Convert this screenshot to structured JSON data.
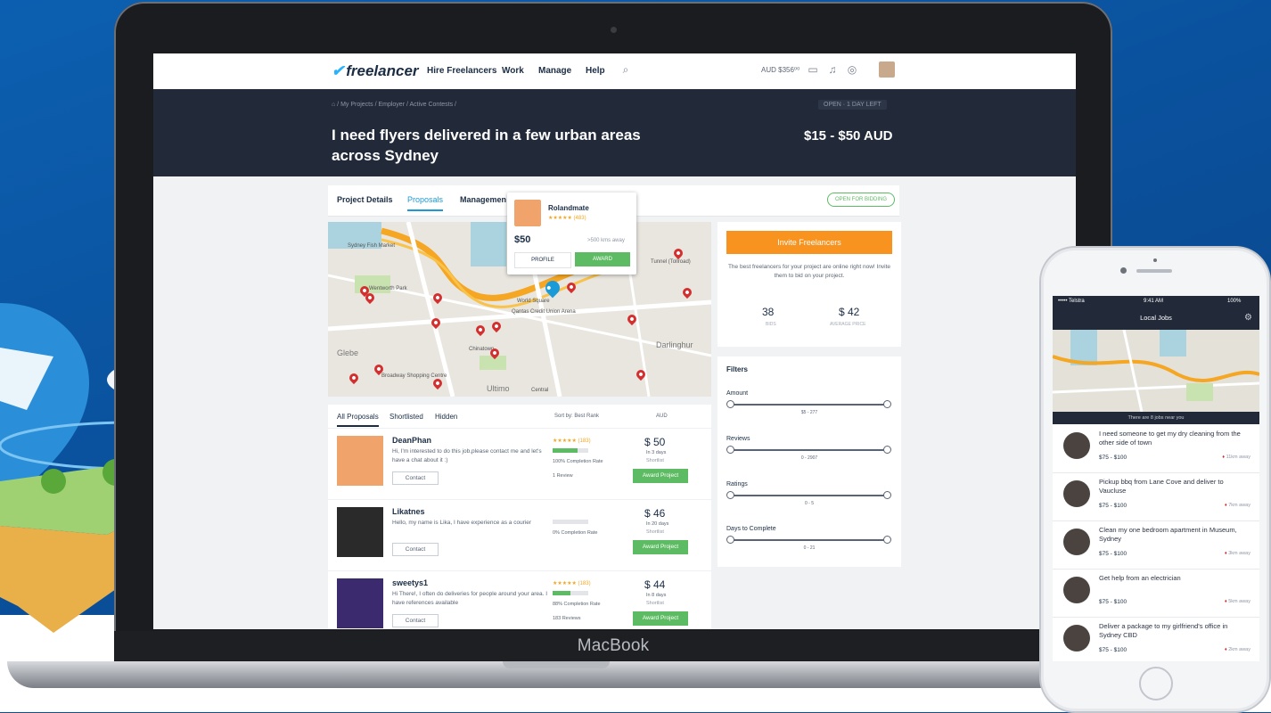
{
  "nav": {
    "logo": "freelancer",
    "links": [
      "Hire Freelancers",
      "Work",
      "Manage",
      "Help"
    ],
    "balance": "AUD $356⁰⁰"
  },
  "banner": {
    "breadcrumb": "⌂ / My Projects / Employer / Active Contests /",
    "status": "OPEN  ·  1 DAY LEFT",
    "title": "I need flyers delivered in a few urban areas across Sydney",
    "budget": "$15 - $50 AUD"
  },
  "tabs": {
    "items": [
      "Project Details",
      "Proposals",
      "Managemen"
    ],
    "open_for_bidding": "OPEN FOR BIDDING"
  },
  "map": {
    "labels": [
      "Sydney Fish Market",
      "Wentworth Park",
      "Glebe",
      "Broadway Shopping Centre",
      "World Square",
      "Qantas Credit Union Arena",
      "Chinatown",
      "Ultimo",
      "Darlinghur",
      "Tunnel (Tollroad)",
      "Central"
    ]
  },
  "popup": {
    "name": "Rolandmate",
    "stars": "★★★★★ (483)",
    "price": "$50",
    "distance": ">500 kms away",
    "profile": "PROFILE",
    "award": "AWARD"
  },
  "invite": {
    "button": "Invite Freelancers",
    "text": "The best freelancers for your project are online right now! Invite them to bid on your project.",
    "bids_value": "38",
    "bids_label": "BIDS",
    "avg_value": "$ 42",
    "avg_label": "AVERAGE PRICE"
  },
  "filters": {
    "title": "Filters",
    "items": [
      {
        "label": "Amount",
        "range": "$5 - 277"
      },
      {
        "label": "Reviews",
        "range": "0 - 2907"
      },
      {
        "label": "Ratings",
        "range": "0 - 5"
      },
      {
        "label": "Days to Complete",
        "range": "0 - 21"
      }
    ]
  },
  "proposals": {
    "tabs": [
      "All Proposals",
      "Shortlisted",
      "Hidden"
    ],
    "sort": "Sort by: Best Rank",
    "currency": "AUD",
    "rows": [
      {
        "name": "DeanPhan",
        "desc": "Hi, I'm interested to do this job,please contact me and let's have a chat about it :)",
        "contact": "Contact",
        "stars": "★★★★★ (183)",
        "rating": 0.7,
        "rate": "100% Completion Rate",
        "reviews": "1 Review",
        "price": "$ 50",
        "days": "In 3 days",
        "shortlist": "Shortlist",
        "award": "Award Project"
      },
      {
        "name": "Likatnes",
        "desc": "Hello, my name is Lika, I have experience as a courier",
        "contact": "Contact",
        "stars": "",
        "rating": 0.0,
        "rate": "0% Completion Rate",
        "reviews": "",
        "price": "$ 46",
        "days": "In 20 days",
        "shortlist": "Shortlist",
        "award": "Award Project"
      },
      {
        "name": "sweetys1",
        "desc": "Hi There!, I often do deliveries for people around your area. I have references available",
        "contact": "Contact",
        "stars": "★★★★★ (183)",
        "rating": 0.5,
        "rate": "88% Completion Rate",
        "reviews": "183 Reviews",
        "price": "$ 44",
        "days": "In 8 days",
        "shortlist": "Shortlist",
        "award": "Award Project"
      }
    ]
  },
  "laptop": {
    "brand": "MacBook"
  },
  "phone": {
    "carrier": "••••• Telstra",
    "time": "9:41 AM",
    "battery": "100%",
    "title": "Local Jobs",
    "near": "There are 8 jobs near you",
    "jobs": [
      {
        "title": "I need someone to get my dry cleaning from the other side of town",
        "price": "$75 - $100",
        "distance": "11km away"
      },
      {
        "title": "Pickup bbq from Lane Cove and deliver to Vaucluse",
        "price": "$75 - $100",
        "distance": "7km away"
      },
      {
        "title": "Clean my one bedroom apartment in Museum, Sydney",
        "price": "$75 - $100",
        "distance": "3km away"
      },
      {
        "title": "Get help from an electrician",
        "price": "$75 - $100",
        "distance": "5km away"
      },
      {
        "title": "Deliver a package to my girlfriend's office in Sydney CBD",
        "price": "$75 - $100",
        "distance": "2km away"
      }
    ]
  }
}
